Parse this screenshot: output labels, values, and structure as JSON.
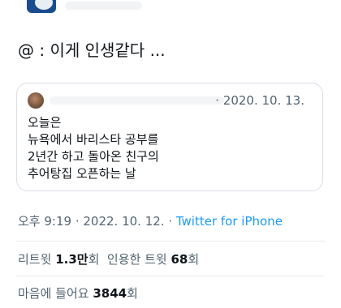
{
  "tweet": {
    "text": "@ : 이게 인생같다 ..."
  },
  "quoted_tweet": {
    "date": "· 2020. 10. 13.",
    "lines": [
      "오늘은",
      "뉴욕에서 바리스타 공부를",
      "2년간 하고 돌아온 친구의",
      "추어탕집 오픈하는 날"
    ]
  },
  "meta": {
    "time_date": "오후 9:19 · 2022. 10. 12. · ",
    "source": "Twitter for iPhone"
  },
  "stats": {
    "retweets_label": "리트윗",
    "retweets_value": "1.3만",
    "retweets_unit": "회",
    "quotes_label": "인용한 트윗",
    "quotes_value": "68",
    "quotes_unit": "회",
    "likes_label": "마음에 들어요",
    "likes_value": "3844",
    "likes_unit": "회"
  },
  "colors": {
    "link": "#1d9bf0",
    "secondary_text": "#536471",
    "primary_text": "#0f1419"
  }
}
